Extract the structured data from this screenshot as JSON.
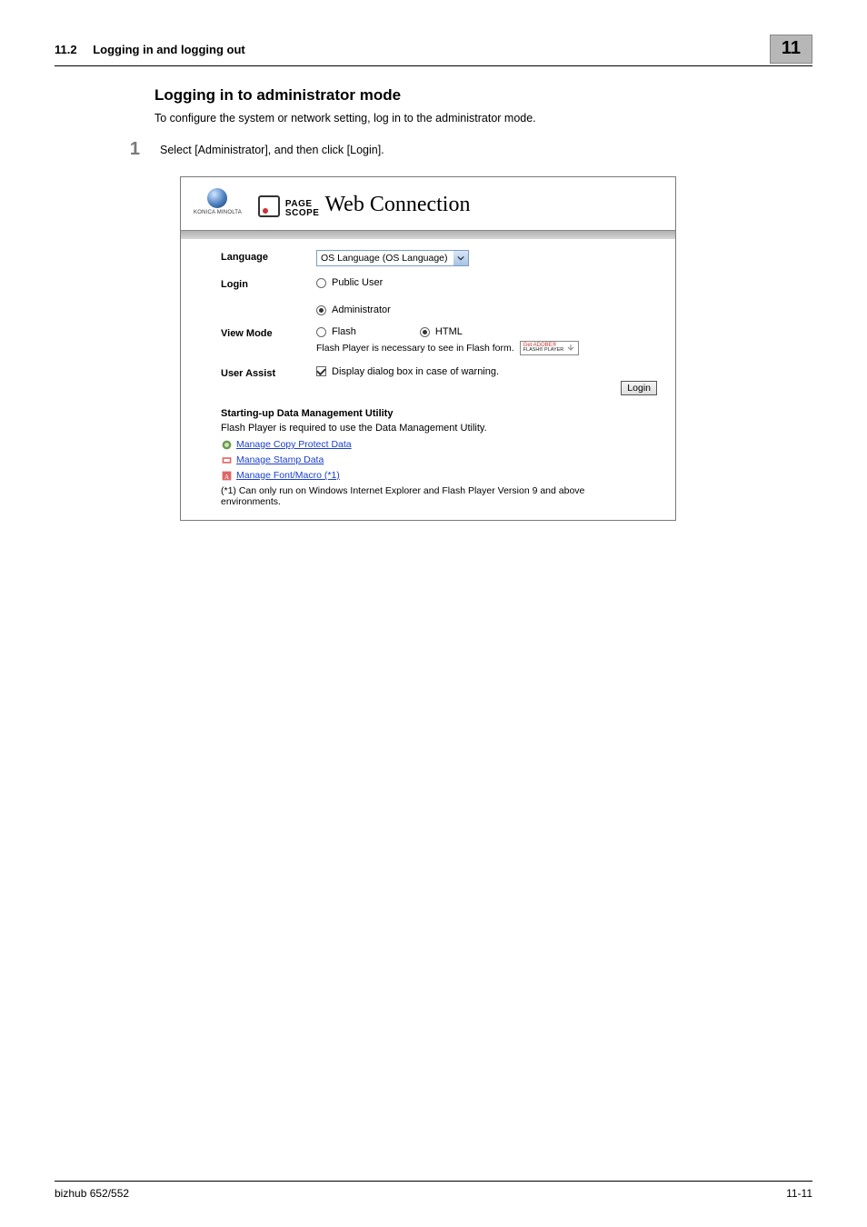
{
  "header": {
    "section_number": "11.2",
    "section_title": "Logging in and logging out",
    "chapter_badge": "11"
  },
  "heading": "Logging in to administrator mode",
  "intro": "To configure the system or network setting, log in to the administrator mode.",
  "step1": {
    "num": "1",
    "text": "Select [Administrator], and then click [Login]."
  },
  "panel": {
    "brand_small": "KONICA MINOLTA",
    "pagescope_upper": "PAGE",
    "pagescope_lower": "SCOPE",
    "webconn": "Web Connection",
    "labels": {
      "language": "Language",
      "login": "Login",
      "view_mode": "View Mode",
      "user_assist": "User Assist"
    },
    "language_value": "OS Language (OS Language)",
    "login_public": "Public User",
    "login_admin": "Administrator",
    "view_flash": "Flash",
    "view_html": "HTML",
    "flash_note": "Flash Player is necessary to see in Flash form.",
    "adobe_top": "Get ADOBE®",
    "adobe_bottom": "FLASH® PLAYER",
    "user_assist_opt": "Display dialog box in case of warning.",
    "login_btn": "Login",
    "dmu": {
      "title": "Starting-up Data Management Utility",
      "note": "Flash Player is required to use the Data Management Utility.",
      "link1": "Manage Copy Protect Data",
      "link2": "Manage Stamp Data",
      "link3": "Manage Font/Macro (*1)",
      "footnote": "(*1) Can only run on Windows Internet Explorer and Flash Player Version 9 and above environments."
    }
  },
  "footer": {
    "left": "bizhub 652/552",
    "right": "11-11"
  }
}
